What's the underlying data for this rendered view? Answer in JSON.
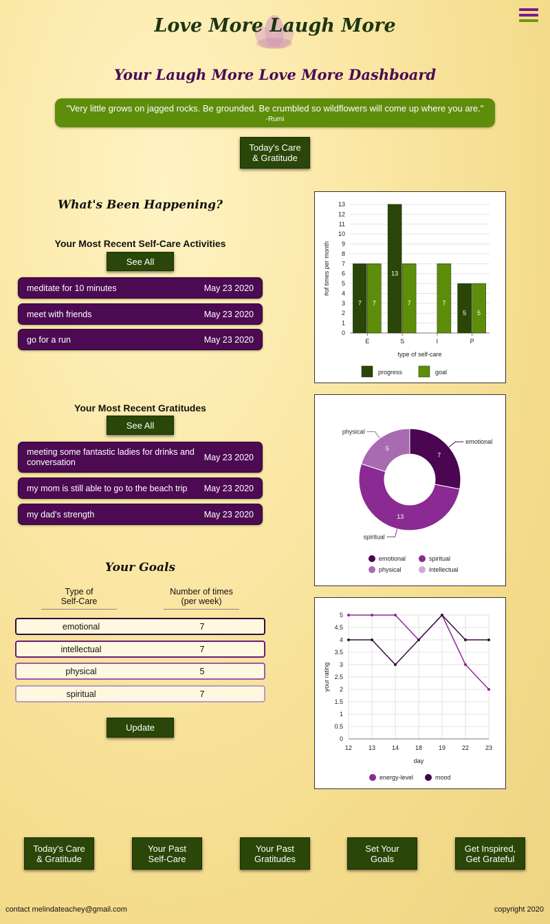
{
  "header": {
    "site_title": "Love More Laugh More",
    "dashboard_title": "Your Laugh More Love More Dashboard"
  },
  "quote": {
    "text": "\"Very little grows on jagged rocks. Be grounded. Be crumbled so wildflowers will come up where you are.\"",
    "author": "-Rumi"
  },
  "top_button": [
    "Today's Care",
    "& Gratitude"
  ],
  "happening": {
    "title": "What's Been Happening?",
    "activities_title": "Your Most Recent Self-Care Activities",
    "see_all": "See All",
    "activities": [
      {
        "text": "meditate for 10 minutes",
        "date": "May 23 2020"
      },
      {
        "text": "meet with friends",
        "date": "May 23 2020"
      },
      {
        "text": "go for a run",
        "date": "May 23 2020"
      }
    ],
    "gratitudes_title": "Your Most Recent Gratitudes",
    "gratitudes": [
      {
        "text": "meeting some fantastic ladies for drinks and conversation",
        "date": "May 23 2020"
      },
      {
        "text": "my mom is still able to go to the beach trip",
        "date": "May 23 2020"
      },
      {
        "text": "my dad's strength",
        "date": "May 23 2020"
      }
    ]
  },
  "goals": {
    "title": "Your Goals",
    "col1": [
      "Type of",
      "Self-Care"
    ],
    "col2": [
      "Number of times",
      "(per week)"
    ],
    "rows": [
      {
        "type": "emotional",
        "value": "7",
        "border": "#2e0a3a"
      },
      {
        "type": "intellectual",
        "value": "7",
        "border": "#6a1a7a"
      },
      {
        "type": "physical",
        "value": "5",
        "border": "#9a5aa8"
      },
      {
        "type": "spiritual",
        "value": "7",
        "border": "#b89ac4"
      }
    ],
    "update": "Update"
  },
  "colors": {
    "dark_green": "#2a4608",
    "light_green": "#5e8d0b",
    "purple": "#4c0a53"
  },
  "chart_data": [
    {
      "type": "bar",
      "categories": [
        "E",
        "S",
        "I",
        "P"
      ],
      "series": [
        {
          "name": "progress",
          "values": [
            7,
            13,
            0,
            5
          ],
          "color": "#2a4608"
        },
        {
          "name": "goal",
          "values": [
            7,
            7,
            7,
            5
          ],
          "color": "#5e8d0b"
        }
      ],
      "xlabel": "type of self-care",
      "ylabel": "#of times per month",
      "ylim": [
        0,
        13
      ],
      "yticks": [
        0,
        1,
        2,
        3,
        4,
        5,
        6,
        7,
        8,
        9,
        10,
        11,
        12,
        13
      ],
      "grid": true,
      "legend": "bottom"
    },
    {
      "type": "pie",
      "donut": true,
      "slices": [
        {
          "label": "emotional",
          "value": 7,
          "color": "#4a0650"
        },
        {
          "label": "spiritual",
          "value": 13,
          "color": "#8a2a92"
        },
        {
          "label": "physical",
          "value": 5,
          "color": "#a86bb2"
        },
        {
          "label": "intellectual",
          "value": 0,
          "color": "#cfa9d6"
        }
      ],
      "legend": "bottom"
    },
    {
      "type": "line",
      "x": [
        "12",
        "13",
        "14",
        "18",
        "19",
        "22",
        "23"
      ],
      "series": [
        {
          "name": "energy-level",
          "values": [
            5,
            5,
            5,
            4,
            5,
            3,
            2
          ],
          "color": "#8a2a92"
        },
        {
          "name": "mood",
          "values": [
            4,
            4,
            3,
            4,
            5,
            4,
            4
          ],
          "color": "#3a0842"
        }
      ],
      "xlabel": "day",
      "ylabel": "your rating",
      "ylim": [
        0,
        5
      ],
      "yticks": [
        "0",
        "0.5",
        "1",
        "1.5",
        "2",
        "2.5",
        "3",
        "3.5",
        "4",
        "4.5",
        "5"
      ],
      "grid": true,
      "legend": "bottom"
    }
  ],
  "footer_nav": [
    [
      "Today's Care",
      "& Gratitude"
    ],
    [
      "Your Past",
      "Self-Care"
    ],
    [
      "Your Past",
      "Gratitudes"
    ],
    [
      "Set Your",
      "Goals"
    ],
    [
      "Get Inspired,",
      "Get Grateful"
    ]
  ],
  "footer": {
    "contact": "contact melindateachey@gmail.com",
    "copyright": "copyright 2020"
  }
}
